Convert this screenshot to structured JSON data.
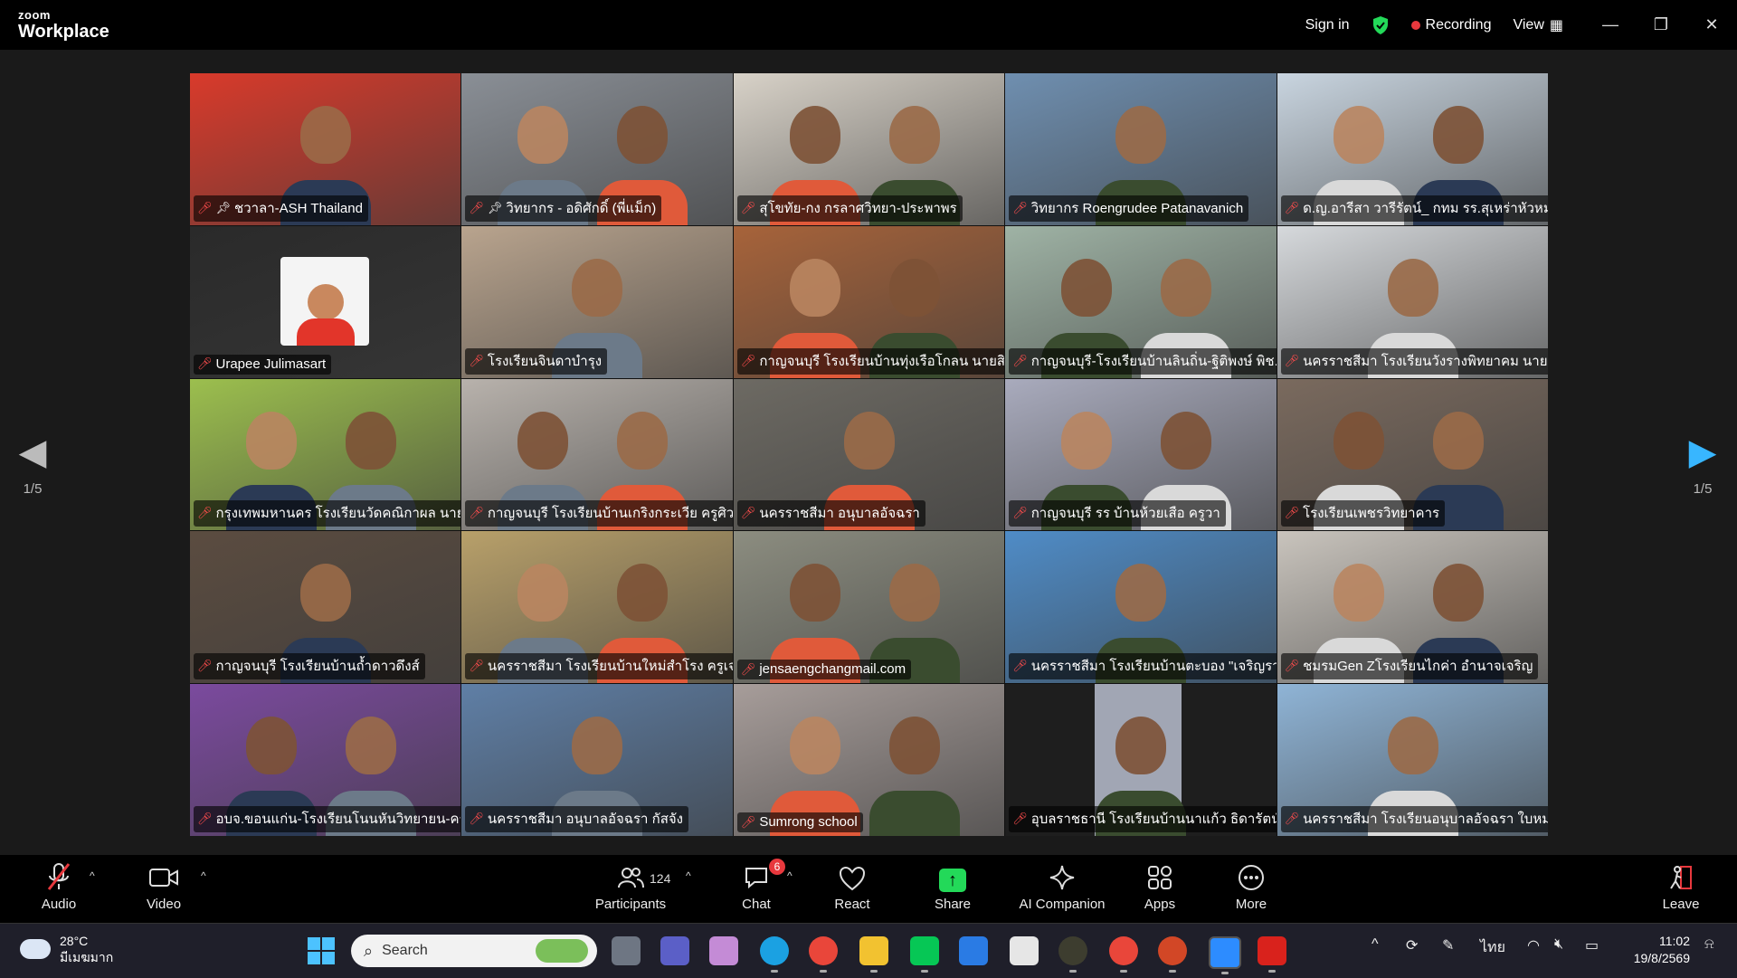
{
  "window": {
    "brand_small": "zoom",
    "brand_large": "Workplace",
    "sign_in": "Sign in",
    "recording": "Recording",
    "view": "View"
  },
  "pager": {
    "left": "1/5",
    "right": "1/5"
  },
  "tiles": [
    {
      "name": "ชวาลา-ASH Thailand",
      "pinned": true,
      "active": true,
      "color": "#d93a2b"
    },
    {
      "name": "วิทยากร - อดิศักดิ์ (พี่แม็ก)",
      "pinned": true,
      "color": "#8a8f96"
    },
    {
      "name": "สุโขทัย-กง กรลาศวิทยา-ประพาพร",
      "color": "#d8d2c8"
    },
    {
      "name": "วิทยากร Roengrudee Patanavanich",
      "color": "#6f8fb0"
    },
    {
      "name": "ด.ญ.อารีสา วารีรัตน์_ กทม รร.สุเหร่าหัวหมา...",
      "color": "#c9d5e0"
    },
    {
      "name": "Urapee Julimasart",
      "avatar": true,
      "color": "#2a2a2a"
    },
    {
      "name": "โรงเรียนจินดาบำรุง",
      "color": "#b9a48e"
    },
    {
      "name": "กาญจนบุรี โรงเรียนบ้านทุ่งเรือโกลน นายสิ...",
      "color": "#a7633a"
    },
    {
      "name": "กาญจนบุรี-โรงเรียนบ้านลินถิ่น-ฐิติพงษ์ พิช...",
      "color": "#9fb3a5"
    },
    {
      "name": "นครราชสีมา โรงเรียนวังรางพิทยาคม นายเจ...",
      "color": "#d6d9dc"
    },
    {
      "name": "กรุงเทพมหานคร โรงเรียนวัดคณิกาผล นาย...",
      "color": "#9cbf4e"
    },
    {
      "name": "กาญจนบุรี โรงเรียนบ้านเกริงกระเวีย ครูศิวดล",
      "color": "#b8b2ac"
    },
    {
      "name": "นครราชสีมา อนุบาลอัจฉรา",
      "color": "#6d6a63"
    },
    {
      "name": "กาญจนบุรี รร บ้านห้วยเสือ ครูวา",
      "color": "#a9abbd"
    },
    {
      "name": "โรงเรียนเพชรวิทยาคาร",
      "color": "#7a6a5e"
    },
    {
      "name": "กาญจนบุรี โรงเรียนบ้านถ้ำดาวดึงส์",
      "color": "#5b4c40"
    },
    {
      "name": "นครราชสีมา โรงเรียนบ้านใหม่สำโรง ครูเจน...",
      "color": "#b8a06a"
    },
    {
      "name": "jensaengchangmail.com",
      "color": "#8c8d80"
    },
    {
      "name": "นครราชสีมา โรงเรียนบ้านตะบอง \"เจริญราษ...",
      "color": "#4f8cc7"
    },
    {
      "name": "ชมรมGen Zโรงเรียนไกค่า อำนาจเจริญ",
      "color": "#c9c4bd"
    },
    {
      "name": "อบจ.ขอนแก่น-โรงเรียนโนนหันวิทยายน-ครู...",
      "color": "#7b4a9e"
    },
    {
      "name": "นครราชสีมา อนุบาลอัจฉรา กัสจัง",
      "color": "#5f7fa6"
    },
    {
      "name": "Sumrong school",
      "color": "#a79d9a"
    },
    {
      "name": "อุบลราชธานี โรงเรียนบ้านนาแก้ว ธิดารัตน์",
      "narrow": true,
      "color": "#a1a6b4"
    },
    {
      "name": "นครราชสีมา โรงเรียนอนุบาลอัจฉรา ใบหม่อน",
      "color": "#8fb4d6"
    }
  ],
  "toolbar": {
    "audio": "Audio",
    "video": "Video",
    "participants": "Participants",
    "participants_count": "124",
    "chat": "Chat",
    "chat_badge": "6",
    "react": "React",
    "share": "Share",
    "ai": "AI Companion",
    "apps": "Apps",
    "more": "More",
    "leave": "Leave"
  },
  "taskbar": {
    "temp": "28°C",
    "weather": "มีเมฆมาก",
    "search": "Search",
    "lang": "ไทย",
    "time": "11:02",
    "date": "19/8/2569"
  }
}
